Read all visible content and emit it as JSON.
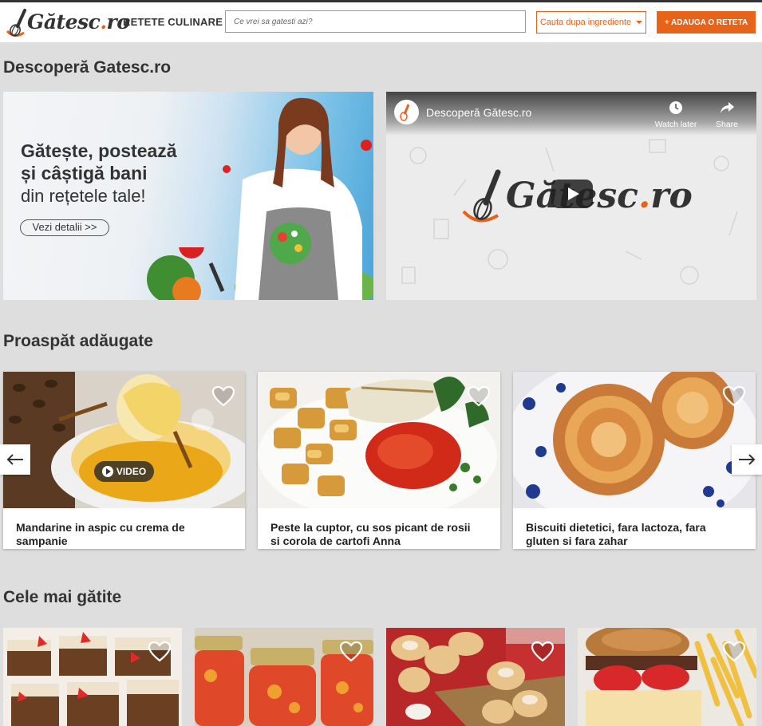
{
  "header": {
    "logo_text": "Gătesc",
    "logo_dot": ".",
    "logo_tld": "ro",
    "nav_recipes": "RETETE CULINARE",
    "search_placeholder": "Ce vrei sa gatesti azi?",
    "ingredients_button": "Cauta dupa ingrediente",
    "add_button": "+ ADAUGA O RETETA",
    "accent_color": "#e8631a"
  },
  "discover": {
    "title": "Descoperă Gatesc.ro",
    "banner": {
      "headline_1": "Gătește, postează",
      "headline_2": "și câștigă bani",
      "subline": "din rețetele tale!",
      "button": "Vezi detalii >>"
    },
    "video": {
      "title": "Descoperă Gătesc.ro",
      "watch_later": "Watch later",
      "share": "Share",
      "logo_text": "Gătesc",
      "logo_dot": ".",
      "logo_tld": "ro"
    }
  },
  "fresh": {
    "title": "Proaspăt adăugate",
    "cards": [
      {
        "title": "Mandarine in aspic cu crema de sampanie",
        "badge": "VIDEO"
      },
      {
        "title": "Peste la cuptor, cu sos picant de rosii si corola de cartofi Anna"
      },
      {
        "title": "Biscuiti dietetici, fara lactoza, fara gluten si fara zahar"
      }
    ]
  },
  "most_cooked": {
    "title": "Cele mai gătite"
  }
}
